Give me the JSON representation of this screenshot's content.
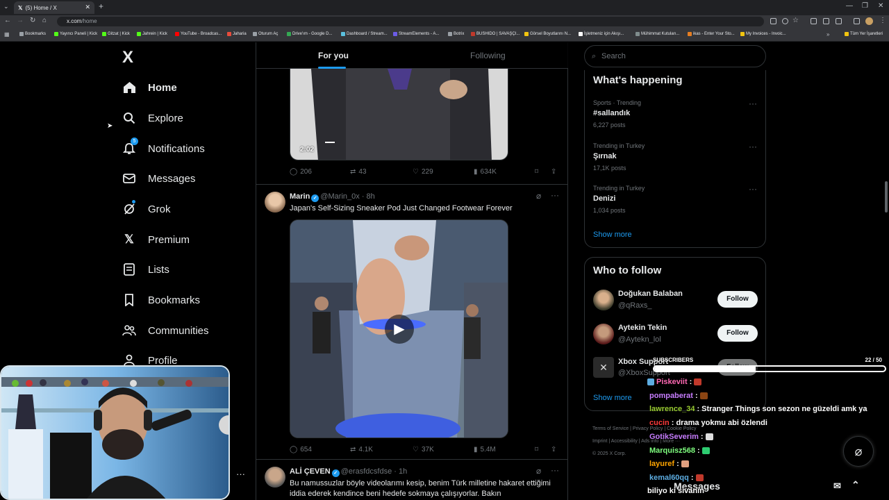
{
  "browser": {
    "tab_title": "(5) Home / X",
    "url_host": "x.com",
    "url_path": "/home",
    "bookmarks": [
      {
        "label": "Bookmarks",
        "color": "#9aa0a6"
      },
      {
        "label": "Yayıncı Paneli | Kick",
        "color": "#53fc18"
      },
      {
        "label": "Gitzat | Kick",
        "color": "#53fc18"
      },
      {
        "label": "Jahrein | Kick",
        "color": "#53fc18"
      },
      {
        "label": "YouTube - Broadcas...",
        "color": "#ff0000"
      },
      {
        "label": "Jaharia",
        "color": "#e74c3c"
      },
      {
        "label": "Oturum Aç",
        "color": "#9aa0a6"
      },
      {
        "label": "Drive'ım - Google D...",
        "color": "#34a853"
      },
      {
        "label": "Dashboard / Stream...",
        "color": "#5bc0de"
      },
      {
        "label": "StreamElements - A...",
        "color": "#6c5ce7"
      },
      {
        "label": "Botrix",
        "color": "#9aa0a6"
      },
      {
        "label": "BUSHIDO | SAVAŞÇI...",
        "color": "#c0392b"
      },
      {
        "label": "Görsel Boyutlarını N...",
        "color": "#f1c40f"
      },
      {
        "label": "İşletmeniz için Akışı...",
        "color": "#ffffff"
      },
      {
        "label": "Mühimmat Kutuları...",
        "color": "#7f8c8d"
      },
      {
        "label": "ikas - Enter Your Sto...",
        "color": "#e67e22"
      },
      {
        "label": "My Invoices - Invoic...",
        "color": "#f1c40f"
      }
    ],
    "all_bookmarks_label": "Tüm Yer İşaretleri"
  },
  "sidebar": {
    "logo": "X",
    "items": [
      {
        "label": "Home",
        "icon": "home-icon"
      },
      {
        "label": "Explore",
        "icon": "search-icon"
      },
      {
        "label": "Notifications",
        "icon": "bell-icon",
        "badge": "5"
      },
      {
        "label": "Messages",
        "icon": "envelope-icon"
      },
      {
        "label": "Grok",
        "icon": "grok-icon"
      },
      {
        "label": "Premium",
        "icon": "x-premium-icon"
      },
      {
        "label": "Lists",
        "icon": "list-icon"
      },
      {
        "label": "Bookmarks",
        "icon": "bookmark-icon"
      },
      {
        "label": "Communities",
        "icon": "people-icon"
      },
      {
        "label": "Profile",
        "icon": "person-icon"
      }
    ]
  },
  "timeline": {
    "tabs": [
      {
        "label": "For you"
      },
      {
        "label": "Following"
      }
    ],
    "post0": {
      "video_time": "2:02",
      "stats": {
        "replies": "206",
        "reposts": "43",
        "likes": "229",
        "views": "634K"
      }
    },
    "post1": {
      "name": "Marin",
      "handle": "@Marin_0x",
      "time": "· 8h",
      "text": "Japan's Self-Sizing Sneaker Pod Just Changed Footwear Forever",
      "stats": {
        "replies": "654",
        "reposts": "4.1K",
        "likes": "37K",
        "views": "5.4M"
      }
    },
    "post2": {
      "name": "ALİ ÇEVEN",
      "handle": "@erasfdcsfdse",
      "time": "· 1h",
      "text": "Bu namussuzlar böyle videolarımı kesip, benim Türk milletine hakaret ettiğimi iddia ederek kendince beni hedefe sokmaya çalışıyorlar. Bakın"
    }
  },
  "right": {
    "search_placeholder": "Search",
    "happening": {
      "title": "What's happening",
      "trends": [
        {
          "meta": "Sports · Trending",
          "title": "#sallandık",
          "count": "6,227 posts"
        },
        {
          "meta": "Trending in Turkey",
          "title": "Şırnak",
          "count": "17,1K posts"
        },
        {
          "meta": "Trending in Turkey",
          "title": "Denizi",
          "count": "1,034 posts"
        }
      ],
      "show_more": "Show more"
    },
    "who_to_follow": {
      "title": "Who to follow",
      "users": [
        {
          "name": "Doğukan Balaban",
          "handle": "@qRaxs_",
          "button": "Follow"
        },
        {
          "name": "Aytekin Tekin",
          "handle": "@Aytekn_lol",
          "button": "Follow"
        },
        {
          "name": "Xbox Support",
          "handle": "@XboxSupport",
          "button": "Follow"
        }
      ],
      "show_more": "Show more"
    },
    "footer": {
      "line1": "Terms of Service  |  Privacy Policy  |  Cookie Policy",
      "line2": "Imprint  |  Accessibility  |  Ads info  |  More ···",
      "copyright": "© 2025 X Corp."
    },
    "messages_label": "Messages"
  },
  "overlay": {
    "subs": {
      "label": "SUBSCRIBERS",
      "current": 22,
      "goal": 50,
      "text": "22  / 50"
    },
    "chat": [
      {
        "user": "Piskeviit",
        "msg": ":",
        "color": "#ff69b4",
        "emote": "#c0392b"
      },
      {
        "user": "pompaberat",
        "msg": ":",
        "color": "#c77dff",
        "emote": "#8b4513"
      },
      {
        "user": "lawrence_34",
        "msg": ": Stranger Things son sezon ne güzeldi amk ya",
        "color": "#9acd32",
        "emote": ""
      },
      {
        "user": "cucin",
        "msg": ": drama yokmu abi özlendi",
        "color": "#ff3b3b",
        "emote": ""
      },
      {
        "user": "GotikSeverim",
        "msg": ":",
        "color": "#c77dff",
        "emote": "#ddd"
      },
      {
        "user": "Marquisz568",
        "msg": ":",
        "color": "#7fff7f",
        "emote": "#2ecc71"
      },
      {
        "user": "layuref",
        "msg": ":",
        "color": "#ffa500",
        "emote": "#e0a080"
      },
      {
        "user": "kemal60qq",
        "msg": ":",
        "color": "#5dade2",
        "emote": "#c0392b"
      },
      {
        "user": "",
        "msg": "biliyo ki sivanın",
        "color": "#ffffff",
        "emote": ""
      }
    ]
  }
}
